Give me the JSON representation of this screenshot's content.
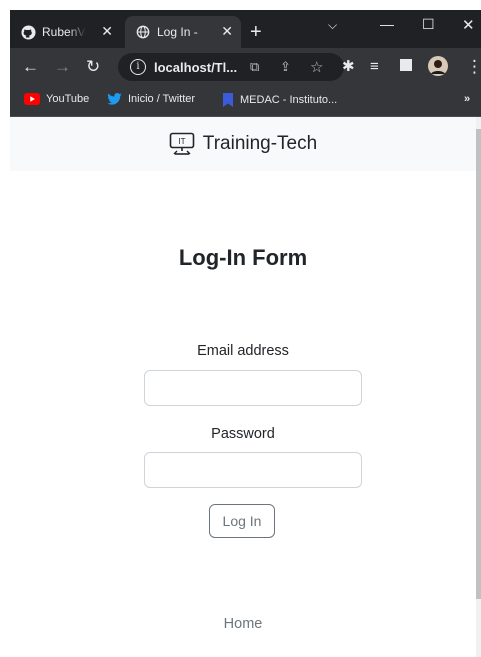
{
  "browser": {
    "tabs": [
      {
        "title": "RubenVa",
        "icon": "github-icon"
      },
      {
        "title": "Log In - ",
        "icon": "globe-icon",
        "active": true
      }
    ],
    "address": "localhost/Tl...",
    "bookmarks": [
      {
        "label": "YouTube",
        "icon": "youtube-icon",
        "color": "#ff0000"
      },
      {
        "label": "Inicio / Twitter",
        "icon": "twitter-icon",
        "color": "#1d9bf0"
      },
      {
        "label": "MEDAC - Instituto...",
        "icon": "bookmark-icon",
        "color": "#3b5bdb"
      }
    ],
    "overflow_label": "»"
  },
  "navbar": {
    "brand": "Training-Tech",
    "logo_text": "IT"
  },
  "form": {
    "title": "Log-In Form",
    "email_label": "Email address",
    "email_value": "",
    "password_label": "Password",
    "password_value": "",
    "submit_label": "Log In"
  },
  "footer": {
    "home_link": "Home"
  }
}
